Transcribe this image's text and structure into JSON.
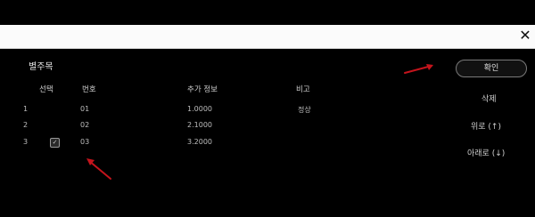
{
  "window": {
    "close_label": "✕"
  },
  "title": "별주목",
  "columns": [
    "선택",
    "번호",
    "추가 정보",
    "비고"
  ],
  "rows": [
    {
      "index": "1",
      "checked": false,
      "number": "01",
      "info": "1.0000",
      "note": "정상"
    },
    {
      "index": "2",
      "checked": false,
      "number": "02",
      "info": "2.1000",
      "note": ""
    },
    {
      "index": "3",
      "checked": true,
      "number": "03",
      "info": "3.2000",
      "note": ""
    }
  ],
  "actions": {
    "confirm_label": "확인",
    "delete_label": "삭제",
    "up_label": "위로 (↑)",
    "down_label": "아래로 (↓)"
  },
  "colors": {
    "annotation_arrow": "#c4141c"
  }
}
